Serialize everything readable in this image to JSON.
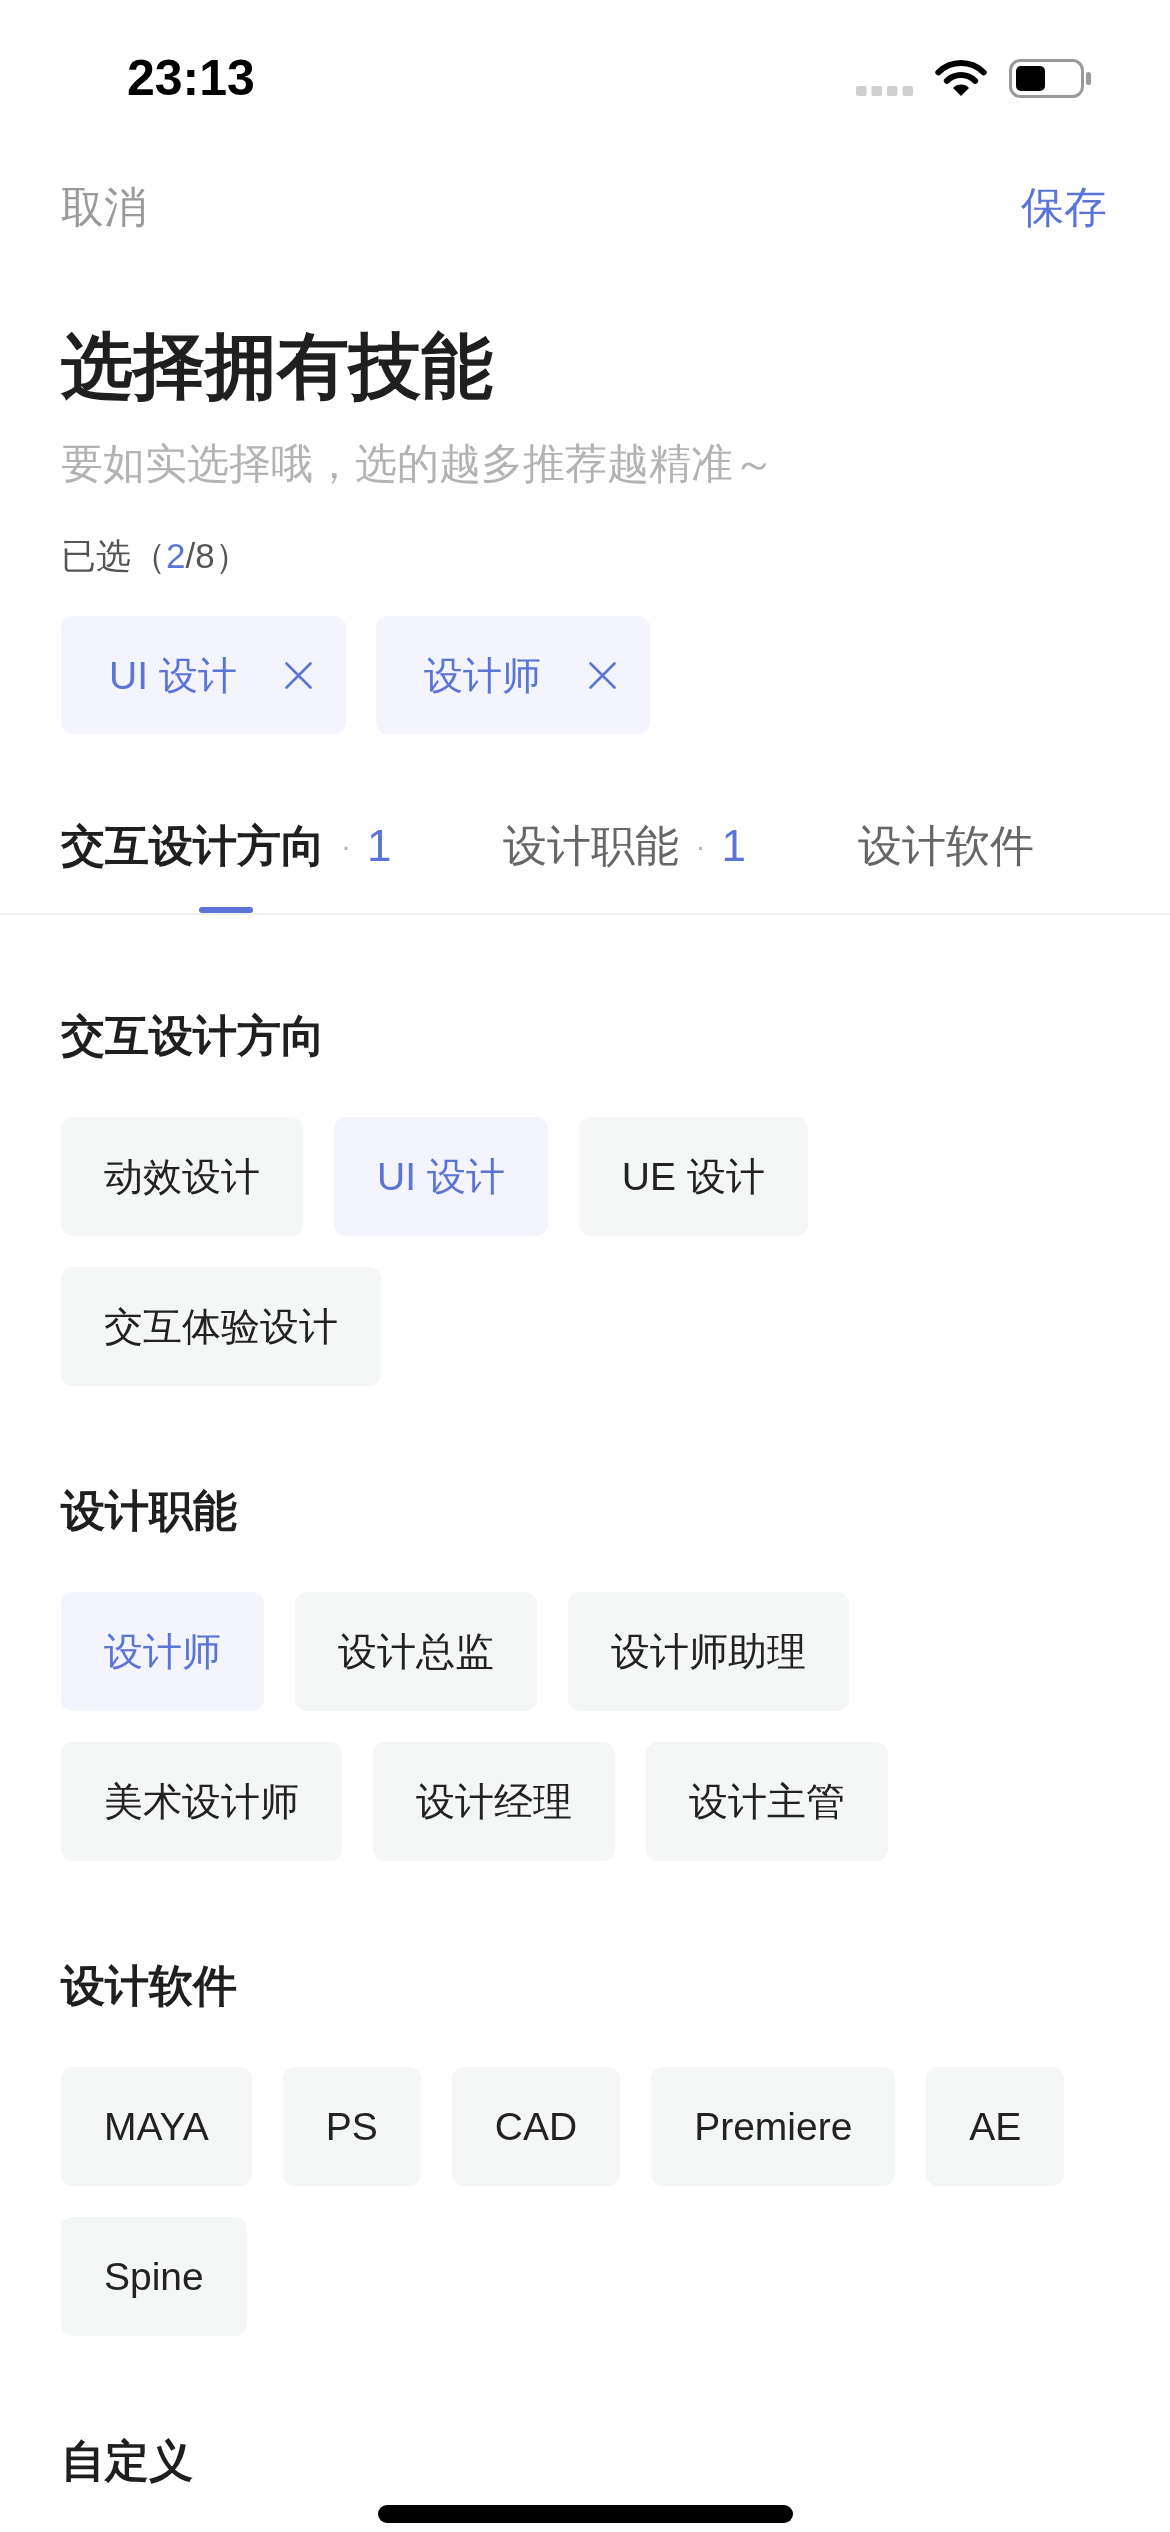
{
  "status_bar": {
    "time": "23:13"
  },
  "nav": {
    "cancel": "取消",
    "save": "保存"
  },
  "header": {
    "title": "选择拥有技能",
    "subtitle": "要如实选择哦，选的越多推荐越精准～"
  },
  "selection": {
    "prefix": "已选（",
    "count": "2",
    "suffix": "/8）",
    "tags": [
      {
        "label": "UI 设计"
      },
      {
        "label": "设计师"
      }
    ]
  },
  "tabs": [
    {
      "label": "交互设计方向",
      "separator": "·",
      "count": "1",
      "selected": true
    },
    {
      "label": "设计职能",
      "separator": "·",
      "count": "1",
      "selected": false
    },
    {
      "label": "设计软件",
      "selected": false
    }
  ],
  "sections": [
    {
      "title": "交互设计方向",
      "options": [
        {
          "label": "动效设计",
          "selected": false
        },
        {
          "label": "UI 设计",
          "selected": true
        },
        {
          "label": "UE 设计",
          "selected": false
        },
        {
          "label": "交互体验设计",
          "selected": false
        }
      ]
    },
    {
      "title": "设计职能",
      "options": [
        {
          "label": "设计师",
          "selected": true
        },
        {
          "label": "设计总监",
          "selected": false
        },
        {
          "label": "设计师助理",
          "selected": false
        },
        {
          "label": "美术设计师",
          "selected": false
        },
        {
          "label": "设计经理",
          "selected": false
        },
        {
          "label": "设计主管",
          "selected": false
        }
      ]
    },
    {
      "title": "设计软件",
      "options": [
        {
          "label": "MAYA",
          "selected": false
        },
        {
          "label": "PS",
          "selected": false
        },
        {
          "label": "CAD",
          "selected": false
        },
        {
          "label": "Premiere",
          "selected": false
        },
        {
          "label": "AE",
          "selected": false
        },
        {
          "label": "Spine",
          "selected": false
        }
      ]
    },
    {
      "title": "自定义"
    }
  ]
}
